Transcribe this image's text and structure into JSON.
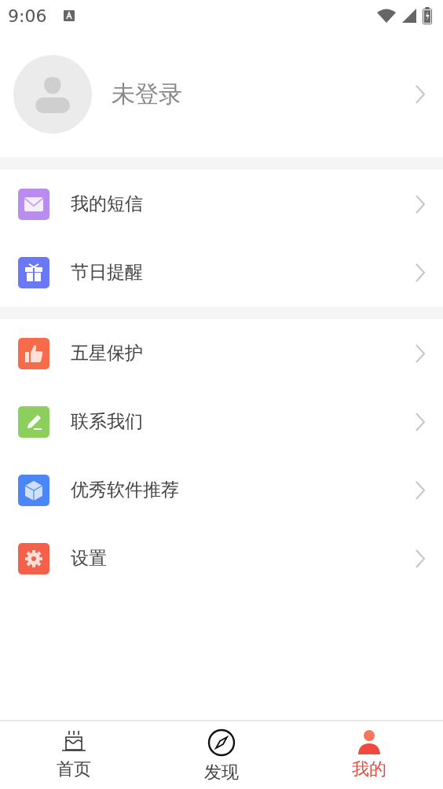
{
  "status_bar": {
    "time": "9:06"
  },
  "profile": {
    "name": "未登录"
  },
  "menu_groups": [
    [
      {
        "label": "我的短信",
        "kind": "mail",
        "color": "#b98cf0"
      },
      {
        "label": "节日提醒",
        "kind": "gift",
        "color": "#6a78f5"
      }
    ],
    [
      {
        "label": "五星保护",
        "kind": "thumb",
        "color": "#f76a4a"
      },
      {
        "label": "联系我们",
        "kind": "edit",
        "color": "#8ccf5c"
      },
      {
        "label": "优秀软件推荐",
        "kind": "cube",
        "color": "#4a86f5"
      },
      {
        "label": "设置",
        "kind": "gear",
        "color": "#f5604a"
      }
    ]
  ],
  "bottom_nav": [
    {
      "label": "首页",
      "kind": "cake",
      "selected": false
    },
    {
      "label": "发现",
      "kind": "compass",
      "selected": false
    },
    {
      "label": "我的",
      "kind": "person",
      "selected": true
    }
  ]
}
